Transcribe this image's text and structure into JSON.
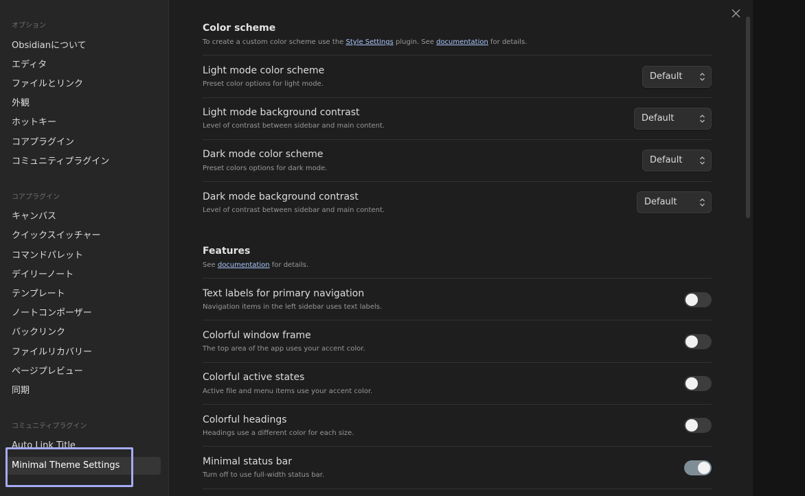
{
  "sidebar": {
    "sections": [
      {
        "label": "オプション",
        "items": [
          "Obsidianについて",
          "エディタ",
          "ファイルとリンク",
          "外観",
          "ホットキー",
          "コアプラグイン",
          "コミュニティプラグイン"
        ]
      },
      {
        "label": "コアプラグイン",
        "items": [
          "キャンバス",
          "クイックスイッチャー",
          "コマンドパレット",
          "デイリーノート",
          "テンプレート",
          "ノートコンポーザー",
          "バックリンク",
          "ファイルリカバリー",
          "ページプレビュー",
          "同期"
        ]
      },
      {
        "label": "コミュニティプラグイン",
        "items": [
          "Auto Link Title",
          "Minimal Theme Settings"
        ]
      }
    ],
    "active_item": "Minimal Theme Settings"
  },
  "close_icon": "close-icon",
  "color_scheme": {
    "title": "Color scheme",
    "desc_part1": "To create a custom color scheme use the ",
    "desc_link1": "Style Settings",
    "desc_part2": " plugin. See ",
    "desc_link2": "documentation",
    "desc_part3": " for details.",
    "settings": [
      {
        "title": "Light mode color scheme",
        "desc": "Preset color options for light mode.",
        "value": "Default"
      },
      {
        "title": "Light mode background contrast",
        "desc": "Level of contrast between sidebar and main content.",
        "value": "Default"
      },
      {
        "title": "Dark mode color scheme",
        "desc": "Preset colors options for dark mode.",
        "value": "Default"
      },
      {
        "title": "Dark mode background contrast",
        "desc": "Level of contrast between sidebar and main content.",
        "value": "Default"
      }
    ]
  },
  "features": {
    "title": "Features",
    "desc_part1": "See ",
    "desc_link": "documentation",
    "desc_part2": " for details.",
    "settings": [
      {
        "title": "Text labels for primary navigation",
        "desc": "Navigation items in the left sidebar uses text labels.",
        "enabled": false
      },
      {
        "title": "Colorful window frame",
        "desc": "The top area of the app uses your accent color.",
        "enabled": false
      },
      {
        "title": "Colorful active states",
        "desc": "Active file and menu items use your accent color.",
        "enabled": false
      },
      {
        "title": "Colorful headings",
        "desc": "Headings use a different color for each size.",
        "enabled": false
      },
      {
        "title": "Minimal status bar",
        "desc": "Turn off to use full-width status bar.",
        "enabled": true
      }
    ]
  },
  "colors": {
    "accent_toggle_on": "#7f8d96",
    "highlight_box": "#a6acf2",
    "link": "#a8c7fa"
  }
}
